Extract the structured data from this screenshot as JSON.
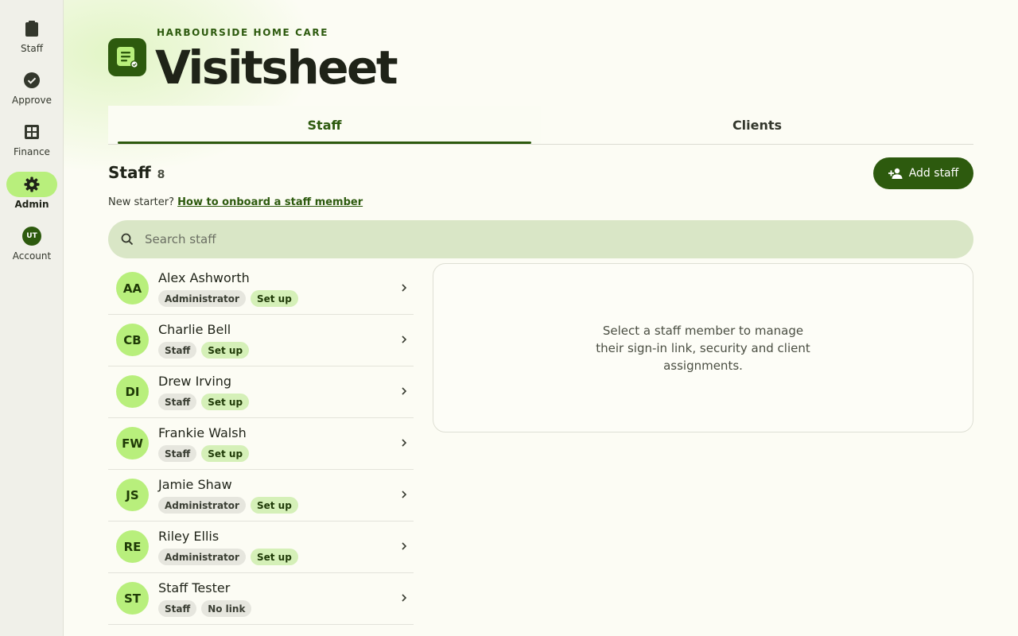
{
  "sidebar": {
    "items": [
      {
        "label": "Staff",
        "icon": "clipboard-icon"
      },
      {
        "label": "Approve",
        "icon": "check-circle-icon"
      },
      {
        "label": "Finance",
        "icon": "table-icon"
      },
      {
        "label": "Admin",
        "icon": "gear-icon",
        "active": true
      },
      {
        "label": "Account",
        "avatar": "UT"
      }
    ]
  },
  "header": {
    "org_name": "HARBOURSIDE HOME CARE",
    "app_title": "Visitsheet"
  },
  "tabs": [
    {
      "label": "Staff",
      "active": true
    },
    {
      "label": "Clients"
    }
  ],
  "section": {
    "title": "Staff",
    "count": "8",
    "add_button": "Add staff",
    "onboard_prefix": "New starter?",
    "onboard_link": "How to onboard a staff member"
  },
  "search": {
    "placeholder": "Search staff",
    "value": ""
  },
  "staff": [
    {
      "initials": "AA",
      "name": "Alex Ashworth",
      "role": "Administrator",
      "status": "Set up"
    },
    {
      "initials": "CB",
      "name": "Charlie Bell",
      "role": "Staff",
      "status": "Set up"
    },
    {
      "initials": "DI",
      "name": "Drew Irving",
      "role": "Staff",
      "status": "Set up"
    },
    {
      "initials": "FW",
      "name": "Frankie Walsh",
      "role": "Staff",
      "status": "Set up"
    },
    {
      "initials": "JS",
      "name": "Jamie Shaw",
      "role": "Administrator",
      "status": "Set up"
    },
    {
      "initials": "RE",
      "name": "Riley Ellis",
      "role": "Administrator",
      "status": "Set up"
    },
    {
      "initials": "ST",
      "name": "Staff Tester",
      "role": "Staff",
      "status": "No link"
    }
  ],
  "detail": {
    "empty_text": "Select a staff member to manage their sign-in link, security and client assignments."
  },
  "colors": {
    "brand": "#2d5a0e",
    "accent": "#b8ef7c",
    "search_bg": "#d9e6c6"
  }
}
